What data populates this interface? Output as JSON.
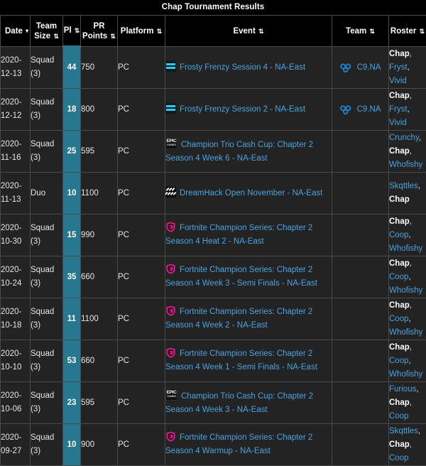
{
  "title": "Chap Tournament Results",
  "colors": {
    "accent_pl": "#26778f",
    "link": "#4aa3e0",
    "row_bg": "#232323",
    "header_bg": "#000000",
    "border": "#4a4a4a",
    "fcs_pink": "#e0218a",
    "frosty_cyan": "#35c8e8",
    "c9_blue": "#1f7fc4"
  },
  "table": {
    "columns": [
      {
        "key": "date",
        "label": "Date",
        "sort": "desc"
      },
      {
        "key": "size",
        "label": "Team Size",
        "sort": "both"
      },
      {
        "key": "pl",
        "label": "Pl",
        "sort": "both"
      },
      {
        "key": "pr",
        "label": "PR Points",
        "sort": "both"
      },
      {
        "key": "platform",
        "label": "Platform",
        "sort": "both"
      },
      {
        "key": "event",
        "label": "Event",
        "sort": "both"
      },
      {
        "key": "team",
        "label": "Team",
        "sort": "both"
      },
      {
        "key": "roster",
        "label": "Roster",
        "sort": "both"
      }
    ],
    "sort_glyphs": {
      "desc": "▾",
      "both": "⇅"
    },
    "rows": [
      {
        "date": "2020-12-13",
        "size": "Squad (3)",
        "pl": "44",
        "pr": "750",
        "platform": "PC",
        "event_icon": "frosty-frenzy-icon",
        "event": "Frosty Frenzy Session 4 - NA-East",
        "team_icon": "cloud9-icon",
        "team": "C9.NA",
        "roster": [
          {
            "name": "Chap",
            "self": true
          },
          {
            "name": "Fryst",
            "self": false
          },
          {
            "name": "Vivid",
            "self": false
          }
        ]
      },
      {
        "date": "2020-12-12",
        "size": "Squad (3)",
        "pl": "18",
        "pr": "800",
        "platform": "PC",
        "event_icon": "frosty-frenzy-icon",
        "event": "Frosty Frenzy Session 2 - NA-East",
        "team_icon": "cloud9-icon",
        "team": "C9.NA",
        "roster": [
          {
            "name": "Chap",
            "self": true
          },
          {
            "name": "Fryst",
            "self": false
          },
          {
            "name": "Vivid",
            "self": false
          }
        ]
      },
      {
        "date": "2020-11-16",
        "size": "Squad (3)",
        "pl": "25",
        "pr": "595",
        "platform": "PC",
        "event_icon": "epic-games-icon",
        "event": "Champion Trio Cash Cup: Chapter 2 Season 4 Week 6 - NA-East",
        "team_icon": "",
        "team": "",
        "roster": [
          {
            "name": "Crunchy",
            "self": false
          },
          {
            "name": "Chap",
            "self": true
          },
          {
            "name": "Whofishy",
            "self": false
          }
        ]
      },
      {
        "date": "2020-11-13",
        "size": "Duo",
        "pl": "10",
        "pr": "1100",
        "platform": "PC",
        "event_icon": "dreamhack-icon",
        "event": "DreamHack Open November - NA-East",
        "team_icon": "",
        "team": "",
        "roster": [
          {
            "name": "Skqttles",
            "self": false
          },
          {
            "name": "Chap",
            "self": true
          }
        ]
      },
      {
        "date": "2020-10-30",
        "size": "Squad (3)",
        "pl": "15",
        "pr": "990",
        "platform": "PC",
        "event_icon": "fcs-icon",
        "event": "Fortnite Champion Series: Chapter 2 Season 4 Heat 2 - NA-East",
        "team_icon": "",
        "team": "",
        "roster": [
          {
            "name": "Chap",
            "self": true
          },
          {
            "name": "Coop",
            "self": false
          },
          {
            "name": "Whofishy",
            "self": false
          }
        ]
      },
      {
        "date": "2020-10-24",
        "size": "Squad (3)",
        "pl": "35",
        "pr": "660",
        "platform": "PC",
        "event_icon": "fcs-icon",
        "event": "Fortnite Champion Series: Chapter 2 Season 4 Week 3 - Semi Finals - NA-East",
        "team_icon": "",
        "team": "",
        "roster": [
          {
            "name": "Chap",
            "self": true
          },
          {
            "name": "Coop",
            "self": false
          },
          {
            "name": "Whofishy",
            "self": false
          }
        ]
      },
      {
        "date": "2020-10-18",
        "size": "Squad (3)",
        "pl": "11",
        "pr": "1100",
        "platform": "PC",
        "event_icon": "fcs-icon",
        "event": "Fortnite Champion Series: Chapter 2 Season 4 Week 2 - NA-East",
        "team_icon": "",
        "team": "",
        "roster": [
          {
            "name": "Chap",
            "self": true
          },
          {
            "name": "Coop",
            "self": false
          },
          {
            "name": "Whofishy",
            "self": false
          }
        ]
      },
      {
        "date": "2020-10-10",
        "size": "Squad (3)",
        "pl": "53",
        "pr": "660",
        "platform": "PC",
        "event_icon": "fcs-icon",
        "event": "Fortnite Champion Series: Chapter 2 Season 4 Week 1 - Semi Finals - NA-East",
        "team_icon": "",
        "team": "",
        "roster": [
          {
            "name": "Chap",
            "self": true
          },
          {
            "name": "Coop",
            "self": false
          },
          {
            "name": "Whofishy",
            "self": false
          }
        ]
      },
      {
        "date": "2020-10-06",
        "size": "Squad (3)",
        "pl": "23",
        "pr": "595",
        "platform": "PC",
        "event_icon": "epic-games-icon",
        "event": "Champion Trio Cash Cup: Chapter 2 Season 4 Week 3 - NA-East",
        "team_icon": "",
        "team": "",
        "roster": [
          {
            "name": "Furious",
            "self": false
          },
          {
            "name": "Chap",
            "self": true
          },
          {
            "name": "Coop",
            "self": false
          }
        ]
      },
      {
        "date": "2020-09-27",
        "size": "Squad (3)",
        "pl": "10",
        "pr": "900",
        "platform": "PC",
        "event_icon": "fcs-icon",
        "event": "Fortnite Champion Series: Chapter 2 Season 4 Warmup - NA-East",
        "team_icon": "",
        "team": "",
        "roster": [
          {
            "name": "Skqttles",
            "self": false
          },
          {
            "name": "Chap",
            "self": true
          },
          {
            "name": "Coop",
            "self": false
          }
        ]
      }
    ]
  }
}
